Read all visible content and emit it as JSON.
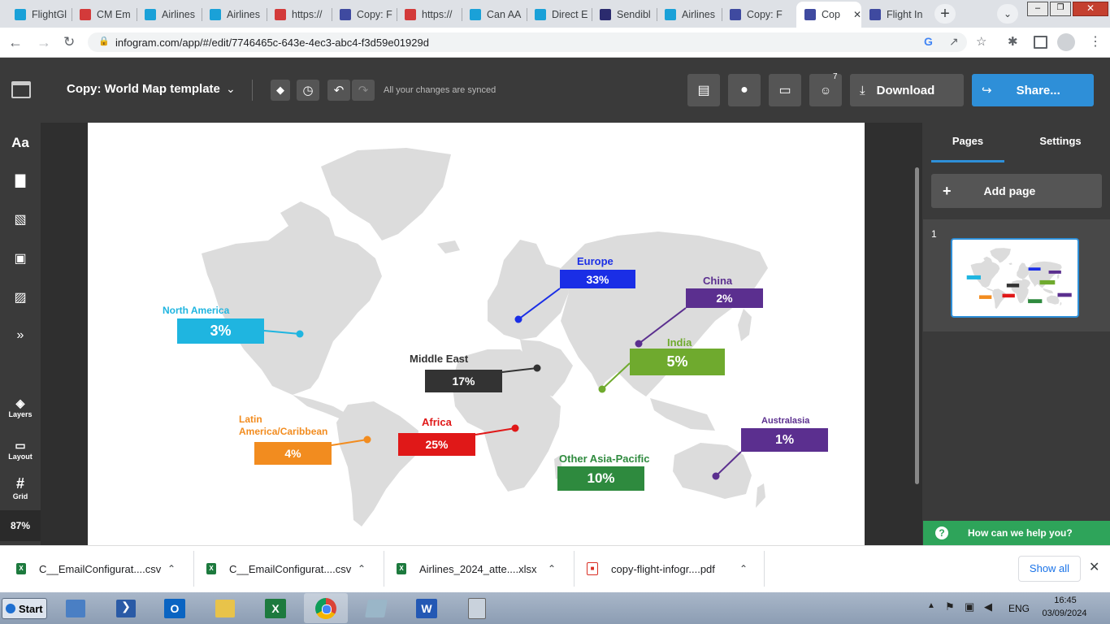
{
  "browser": {
    "tabs": [
      {
        "label": "FlightGl",
        "color": "#1aa1d8"
      },
      {
        "label": "CM Em",
        "color": "#d33a3a"
      },
      {
        "label": "Airlines",
        "color": "#1aa1d8"
      },
      {
        "label": "Airlines",
        "color": "#1aa1d8"
      },
      {
        "label": "https://",
        "color": "#d33a3a"
      },
      {
        "label": "Copy: F",
        "color": "#3f4aa0"
      },
      {
        "label": "https://",
        "color": "#d33a3a"
      },
      {
        "label": "Can AA",
        "color": "#1aa1d8"
      },
      {
        "label": "Direct E",
        "color": "#1aa1d8"
      },
      {
        "label": "Sendibl",
        "color": "#2b2b6e"
      },
      {
        "label": "Airlines",
        "color": "#1aa1d8"
      },
      {
        "label": "Copy: F",
        "color": "#3f4aa0"
      },
      {
        "label": "Cop",
        "color": "#3f4aa0",
        "active": true
      },
      {
        "label": "Flight In",
        "color": "#3f4aa0"
      }
    ],
    "url": "infogram.com/app/#/edit/7746465c-643e-4ec3-abc4-f3d59e01929d"
  },
  "app": {
    "doc_title": "Copy: World Map template",
    "sync_status": "All your changes are synced",
    "collaborators_count": "7",
    "download_label": "Download",
    "share_label": "Share...",
    "share_color": "#2e8fd8",
    "zoom": "87%",
    "rail": {
      "text_icon": "Aa",
      "layers": "Layers",
      "layout": "Layout",
      "grid": "Grid"
    }
  },
  "right_panel": {
    "tabs": [
      "Pages",
      "Settings"
    ],
    "add_page": "Add page",
    "page_number": "1",
    "help": "How can we help you?",
    "help_color": "#2ea45a"
  },
  "map": {
    "regions": [
      {
        "key": "north_america",
        "name": "North America",
        "value": "3%",
        "color": "#1fb5e0"
      },
      {
        "key": "europe",
        "name": "Europe",
        "value": "33%",
        "color": "#1a2ee6"
      },
      {
        "key": "china",
        "name": "China",
        "value": "2%",
        "color": "#5b2f8f"
      },
      {
        "key": "india",
        "name": "India",
        "value": "5%",
        "color": "#6faa2e"
      },
      {
        "key": "middle_east",
        "name": "Middle East",
        "value": "17%",
        "color": "#333333"
      },
      {
        "key": "latin_america",
        "name": "Latin\nAmerica/Caribbean",
        "value": "4%",
        "color": "#f28c1f"
      },
      {
        "key": "africa",
        "name": "Africa",
        "value": "25%",
        "color": "#e01818"
      },
      {
        "key": "australasia",
        "name": "Australasia",
        "value": "1%",
        "color": "#5b2f8f"
      },
      {
        "key": "other_asia",
        "name": "Other Asia-Pacific",
        "value": "10%",
        "color": "#2e8a3e"
      }
    ]
  },
  "downloads": {
    "items": [
      {
        "name": "C__EmailConfigurat....csv",
        "type": "excel"
      },
      {
        "name": "C__EmailConfigurat....csv",
        "type": "excel"
      },
      {
        "name": "Airlines_2024_atte....xlsx",
        "type": "excel"
      },
      {
        "name": "copy-flight-infogr....pdf",
        "type": "pdf"
      }
    ],
    "show_all": "Show all"
  },
  "taskbar": {
    "start": "Start",
    "lang": "ENG",
    "time": "16:45",
    "date": "03/09/2024"
  }
}
